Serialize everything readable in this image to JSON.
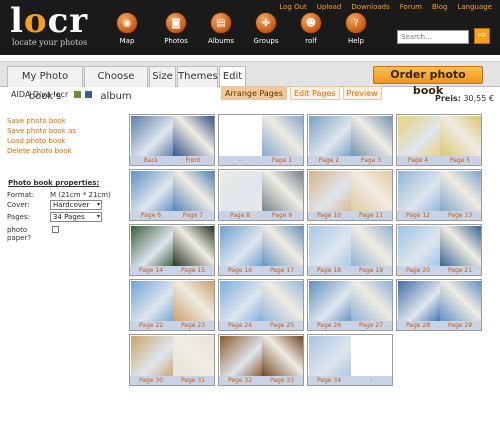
{
  "header": {
    "logo": "locr",
    "tagline": "locate your photos",
    "nav": [
      {
        "label": "Map",
        "icon": "map-icon",
        "glyph": "◉"
      },
      {
        "label": "Photos",
        "icon": "camera-icon",
        "glyph": "◙"
      },
      {
        "label": "Albums",
        "icon": "album-icon",
        "glyph": "▤"
      },
      {
        "label": "Groups",
        "icon": "groups-icon",
        "glyph": "✤"
      },
      {
        "label": "rolf",
        "icon": "user-icon",
        "glyph": "☻"
      },
      {
        "label": "Help",
        "icon": "help-icon",
        "glyph": "?"
      }
    ],
    "toplinks": [
      "Log Out",
      "Upload",
      "Downloads",
      "Forum",
      "Blog",
      "Language"
    ],
    "search_placeholder": "Search...",
    "search_button_glyph": "⇨"
  },
  "tabs": [
    "My Photo book's",
    "Choose album",
    "Size",
    "Themes",
    "Edit"
  ],
  "order_button": "Order photo book",
  "book_title": "AIDA Diva locr",
  "actions": [
    "Save photo book",
    "Save photo book as",
    "Load photo book",
    "Delete photo book"
  ],
  "properties": {
    "title": "Photo book properties:",
    "format_label": "Format:",
    "format_value": "M (21cm * 21cm)",
    "cover_label": "Cover:",
    "cover_value": "Hardcover",
    "pages_label": "Pages:",
    "pages_value": "34 Pages",
    "paper_label": "photo paper?"
  },
  "subtabs": [
    "Arrange Pages",
    "Edit Pages",
    "Preview"
  ],
  "price": {
    "label": "Preis:",
    "value": "30,55 €"
  },
  "select_arrow": "▾",
  "spreads": [
    {
      "left": "Back",
      "right": "Front"
    },
    {
      "left": "-",
      "right": "Page 1"
    },
    {
      "left": "Page 2",
      "right": "Page 3"
    },
    {
      "left": "Page 4",
      "right": "Page 5"
    },
    {
      "left": "Page 6",
      "right": "Page 7"
    },
    {
      "left": "Page 8",
      "right": "Page 9"
    },
    {
      "left": "Page 10",
      "right": "Page 11"
    },
    {
      "left": "Page 12",
      "right": "Page 13"
    },
    {
      "left": "Page 14",
      "right": "Page 15"
    },
    {
      "left": "Page 16",
      "right": "Page 17"
    },
    {
      "left": "Page 18",
      "right": "Page 19"
    },
    {
      "left": "Page 20",
      "right": "Page 21"
    },
    {
      "left": "Page 22",
      "right": "Page 23"
    },
    {
      "left": "Page 24",
      "right": "Page 25"
    },
    {
      "left": "Page 26",
      "right": "Page 27"
    },
    {
      "left": "Page 28",
      "right": "Page 29"
    },
    {
      "left": "Page 30",
      "right": "Page 31"
    },
    {
      "left": "Page 32",
      "right": "Page 33"
    },
    {
      "left": "Page 34",
      "right": "-"
    }
  ],
  "colors": {
    "accent": "#f7a11a",
    "link": "#e06a00",
    "header_bg": "#1a1a1a",
    "label_bar": "#c8d3e6"
  }
}
